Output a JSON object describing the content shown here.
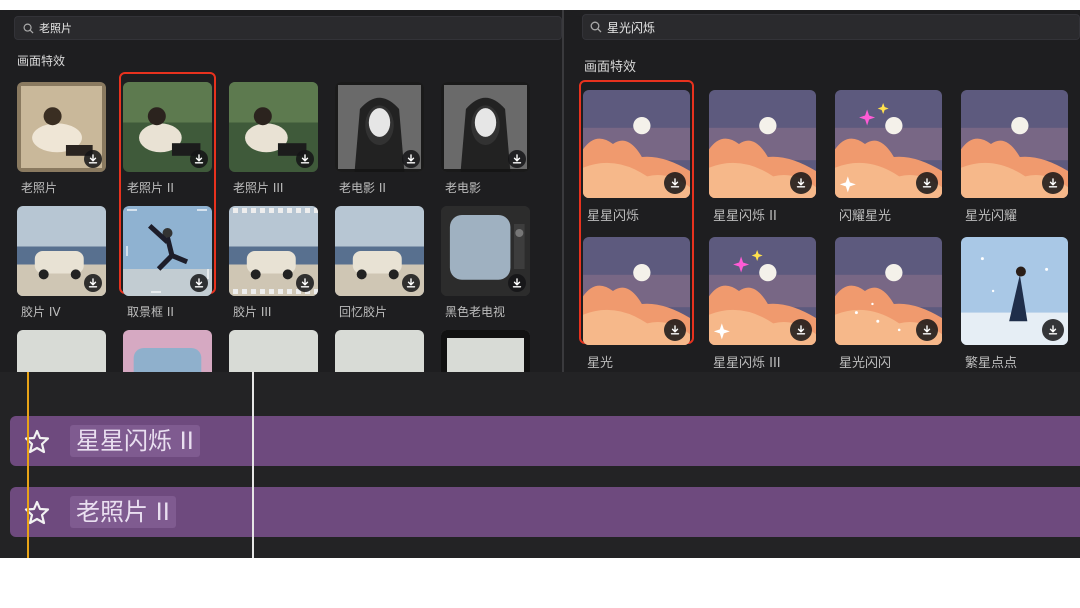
{
  "left_panel": {
    "search": {
      "value": "老照片"
    },
    "section_title": "画面特效",
    "items": [
      {
        "label": "老照片",
        "style": "sepia-portrait"
      },
      {
        "label": "老照片 II",
        "style": "green-portrait",
        "selected": true
      },
      {
        "label": "老照片 III",
        "style": "green-portrait"
      },
      {
        "label": "老电影 II",
        "style": "bw-portrait"
      },
      {
        "label": "老电影",
        "style": "bw-portrait"
      },
      {
        "label": "胶片 IV",
        "style": "car"
      },
      {
        "label": "取景框 II",
        "style": "jump"
      },
      {
        "label": "胶片 III",
        "style": "car-film"
      },
      {
        "label": "回忆胶片",
        "style": "car"
      },
      {
        "label": "黑色老电视",
        "style": "tv"
      },
      {
        "label": "",
        "style": "partial"
      },
      {
        "label": "",
        "style": "partial-pink"
      },
      {
        "label": "",
        "style": "partial"
      },
      {
        "label": "",
        "style": "partial"
      },
      {
        "label": "",
        "style": "partial-film"
      }
    ]
  },
  "right_panel": {
    "search": {
      "value": "星光闪烁"
    },
    "section_title": "画面特效",
    "items": [
      {
        "label": "星星闪烁",
        "style": "sky",
        "selected": true
      },
      {
        "label": "星星闪烁 II",
        "style": "sky"
      },
      {
        "label": "闪耀星光",
        "style": "sky-stars"
      },
      {
        "label": "星光闪耀",
        "style": "sky"
      },
      {
        "label": "星光",
        "style": "sky"
      },
      {
        "label": "星星闪烁 III",
        "style": "sky-stars"
      },
      {
        "label": "星光闪闪",
        "style": "sky-sparkle"
      },
      {
        "label": "繁星点点",
        "style": "snow-girl"
      }
    ]
  },
  "timeline": {
    "tracks": [
      {
        "label": "星星闪烁 II",
        "icon": "effect-star-icon"
      },
      {
        "label": "老照片 II",
        "icon": "effect-star-icon"
      }
    ]
  },
  "colors": {
    "panel_bg": "#1e1e20",
    "highlight": "#e8321e",
    "track": "#6e4a7e",
    "playhead": "#e8a317"
  }
}
